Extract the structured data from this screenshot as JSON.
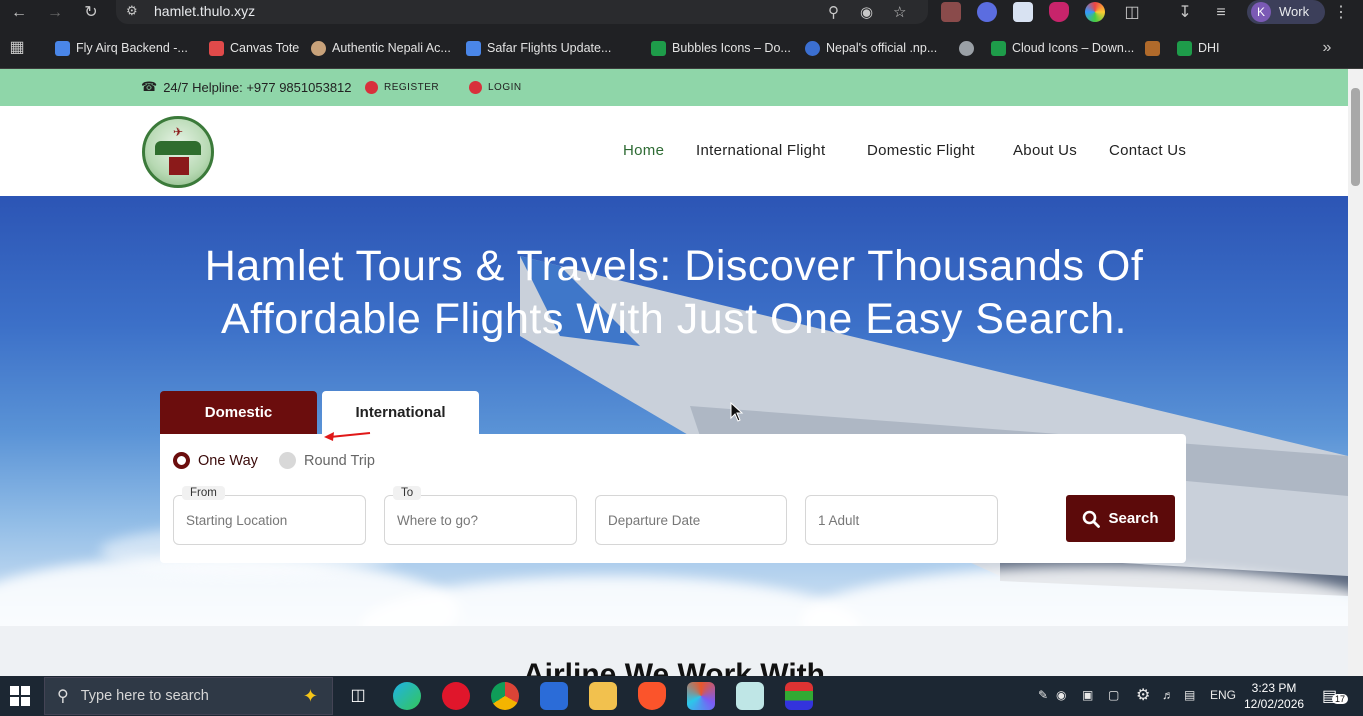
{
  "browser": {
    "url": "hamlet.thulo.xyz",
    "profile_initial": "K",
    "profile_label": "Work",
    "bookmarks": [
      {
        "label": "Fly Airq Backend -...",
        "icon": "docs-icon",
        "color": "#4a86e8"
      },
      {
        "label": "Canvas Tote",
        "icon": "canvas-icon",
        "color": "#e04a4a"
      },
      {
        "label": "Authentic Nepali Ac...",
        "icon": "avatar-icon",
        "color": "#c8a27a"
      },
      {
        "label": "Safar Flights Update...",
        "icon": "docs-icon",
        "color": "#4a86e8"
      },
      {
        "label": "Bubbles Icons – Do...",
        "icon": "sheets-icon",
        "color": "#1e9c4a"
      },
      {
        "label": "Nepal's official .np...",
        "icon": "np-icon",
        "color": "#3b6fd1"
      },
      {
        "label": "",
        "icon": "globe-icon",
        "color": "#9aa0a6"
      },
      {
        "label": "Cloud Icons – Down...",
        "icon": "sheets-icon",
        "color": "#1e9c4a"
      },
      {
        "label": "",
        "icon": "logo-icon",
        "color": "#b06a2b"
      },
      {
        "label": "DHI",
        "icon": "sheets-plus-icon",
        "color": "#1e9c4a"
      }
    ]
  },
  "site": {
    "topbar": {
      "helpline": "24/7 Helpline: +977 9851053812",
      "register": "REGISTER",
      "login": "LOGIN"
    },
    "nav": {
      "home": "Home",
      "international": "International Flight",
      "domestic": "Domestic Flight",
      "about": "About Us",
      "contact": "Contact Us"
    },
    "hero": {
      "title_line1": "Hamlet Tours & Travels: Discover Thousands Of",
      "title_line2": "Affordable Flights With Just One Easy Search."
    },
    "search": {
      "tab_domestic": "Domestic",
      "tab_international": "International",
      "trip_one_way": "One Way",
      "trip_round": "Round Trip",
      "from_label": "From",
      "from_placeholder": "Starting Location",
      "to_label": "To",
      "to_placeholder": "Where to go?",
      "date_placeholder": "Departure Date",
      "passengers": "1 Adult",
      "button": "Search"
    },
    "next_section_title": "Airline We Work With"
  },
  "taskbar": {
    "search_placeholder": "Type here to search",
    "language": "ENG",
    "time": "3:23 PM",
    "date": "12/02/2026",
    "notifications": "17"
  },
  "colors": {
    "primary": "#6b0d0d",
    "topbar": "#8fd6a9",
    "nav_active": "#2e6b34"
  }
}
